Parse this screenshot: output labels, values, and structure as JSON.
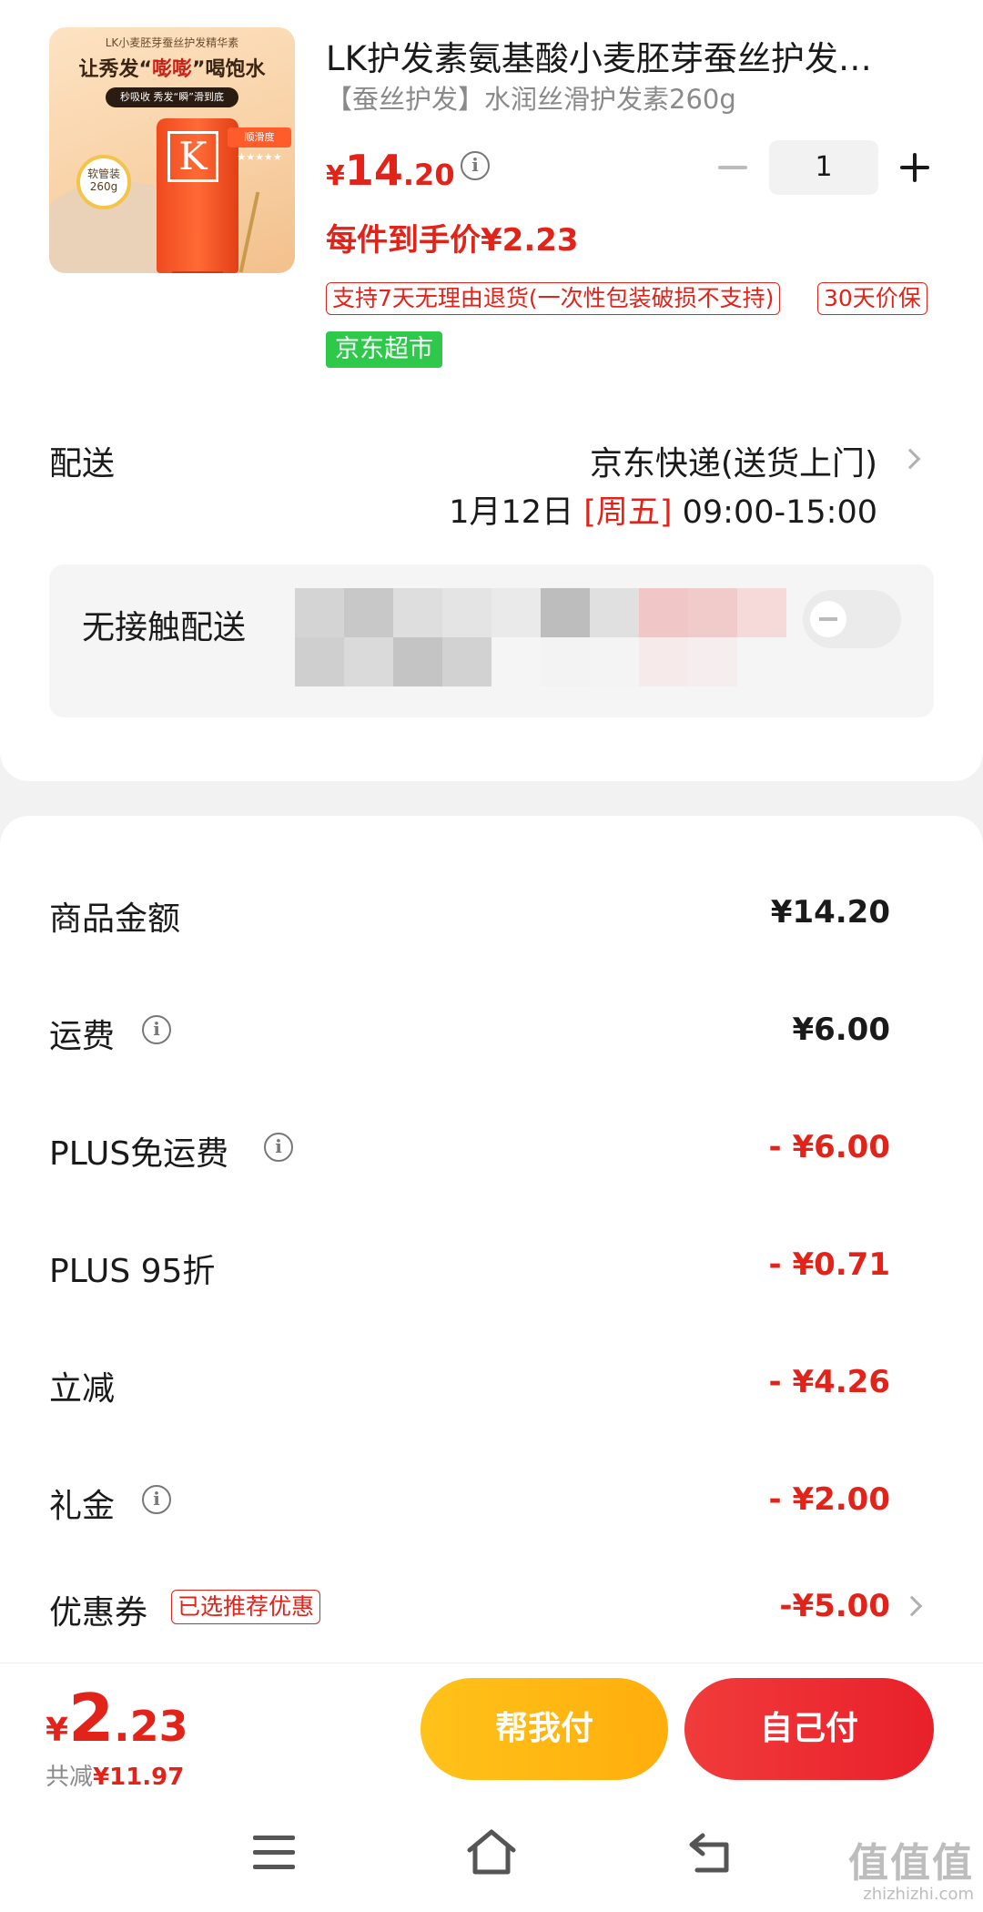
{
  "product": {
    "image": {
      "tag_line": "LK小麦胚芽蚕丝护发精华素",
      "headline_pre": "让秀发“",
      "headline_em": "嘭嘭",
      "headline_post": "”喝饱水",
      "pill": "秒吸收 秀发“瞬”滑到底",
      "badge": "软管装 260g",
      "rating": "顺滑度★★★★★",
      "logo_letter": "K"
    },
    "title": "LK护发素氨基酸小麦胚芽蚕丝护发…",
    "subtitle": "【蚕丝护发】水润丝滑护发素260g",
    "price_currency": "¥",
    "price_int": "14",
    "price_dec": ".20",
    "quantity": "1",
    "unit_price": "每件到手价¥2.23",
    "tags": [
      "支持7天无理由退货(一次性包装破损不支持)",
      "30天价保"
    ],
    "store_tag": "京东超市"
  },
  "delivery": {
    "label": "配送",
    "method": "京东快递(送货上门)",
    "date": "1月12日 ",
    "weekday": "[周五]",
    "hours": " 09:00-15:00",
    "contactless_label": "无接触配送",
    "contactless_enabled": false
  },
  "costs": [
    {
      "label": "商品金额",
      "value": "¥14.20",
      "red": false,
      "info": false
    },
    {
      "label": "运费",
      "value": "¥6.00",
      "red": false,
      "info": true
    },
    {
      "label": "PLUS免运费",
      "value": "- ¥6.00",
      "red": true,
      "info": true
    },
    {
      "label": "PLUS 95折",
      "value": "- ¥0.71",
      "red": true,
      "info": false
    },
    {
      "label": "立减",
      "value": "- ¥4.26",
      "red": true,
      "info": false
    },
    {
      "label": "礼金",
      "value": "- ¥2.00",
      "red": true,
      "info": true
    }
  ],
  "coupon": {
    "label": "优惠券",
    "tag": "已选推荐优惠",
    "value": "-¥5.00"
  },
  "footer": {
    "total_currency": "¥",
    "total_int": "2",
    "total_dec": ".23",
    "saved_label": "共减",
    "saved_value": "¥11.97",
    "help_pay": "帮我付",
    "self_pay": "自己付"
  },
  "watermark": {
    "big": "值值值",
    "small": "zhizhizhi.com"
  },
  "colors": {
    "accent_red": "#e2231a",
    "help_button": "#ffb612",
    "self_button": "#ec2a30",
    "store_green": "#2ec94b"
  },
  "icons": [
    "info-icon",
    "minus-icon",
    "plus-icon",
    "chevron-right-icon",
    "menu-icon",
    "home-icon",
    "back-icon"
  ]
}
